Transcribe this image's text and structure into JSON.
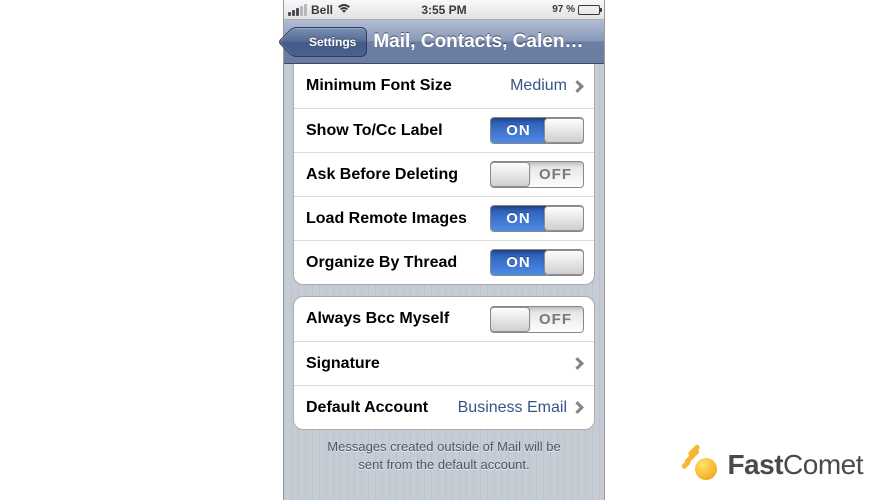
{
  "status": {
    "carrier": "Bell",
    "time": "3:55 PM",
    "battery_pct": "97 %"
  },
  "nav": {
    "back_label": "Settings",
    "title": "Mail, Contacts, Calen…"
  },
  "toggle_labels": {
    "on": "ON",
    "off": "OFF"
  },
  "group1": [
    {
      "label": "Minimum Font Size",
      "value": "Medium",
      "type": "link"
    },
    {
      "label": "Show To/Cc Label",
      "type": "toggle",
      "state": "on"
    },
    {
      "label": "Ask Before Deleting",
      "type": "toggle",
      "state": "off"
    },
    {
      "label": "Load Remote Images",
      "type": "toggle",
      "state": "on"
    },
    {
      "label": "Organize By Thread",
      "type": "toggle",
      "state": "on"
    }
  ],
  "group2": [
    {
      "label": "Always Bcc Myself",
      "type": "toggle",
      "state": "off"
    },
    {
      "label": "Signature",
      "type": "link"
    },
    {
      "label": "Default Account",
      "value": "Business Email",
      "type": "link"
    }
  ],
  "footer": {
    "line1": "Messages created outside of Mail will be",
    "line2": "sent from the default account."
  },
  "brand": {
    "part1": "Fast",
    "part2": "Comet"
  }
}
